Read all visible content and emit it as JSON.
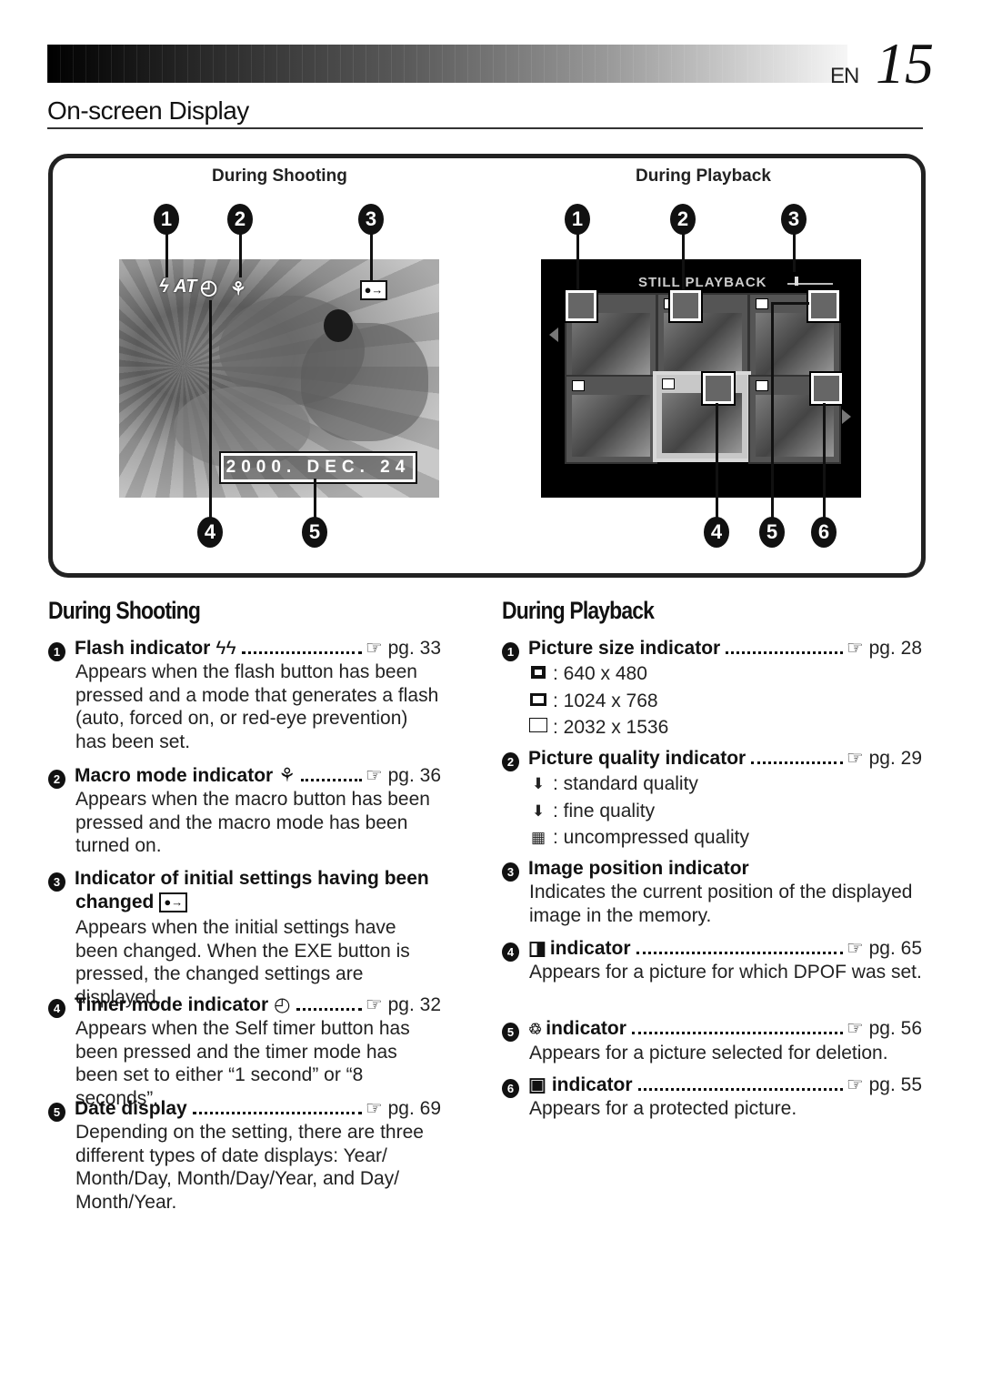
{
  "header": {
    "lang": "EN",
    "page_number": "15"
  },
  "page_title": "On-screen Display",
  "figure": {
    "shooting_caption": "During Shooting",
    "playback_caption": "During Playback",
    "shooting_callouts": [
      "1",
      "2",
      "3",
      "4",
      "5"
    ],
    "playback_callouts": [
      "1",
      "2",
      "3",
      "4",
      "5",
      "6"
    ],
    "shooting_osd": {
      "flash": "ϟ AT",
      "timer": "◴",
      "macro": "⚘",
      "init_changed": "●→",
      "date": "2000. DEC. 24"
    },
    "playback_osd": {
      "title": "STILL PLAYBACK"
    }
  },
  "shooting": {
    "heading": "During Shooting",
    "items": [
      {
        "num": "1",
        "label": "Flash indicator",
        "symbol": "ϟϟ",
        "ref": "☞ pg. 33",
        "desc": "Appears when the flash button has been pressed and a mode that generates a flash (auto, forced on, or red-eye prevention) has been set."
      },
      {
        "num": "2",
        "label": "Macro mode indicator",
        "symbol": "⚘",
        "ref": "☞ pg. 36",
        "desc": "Appears when the macro button has been pressed and the macro mode has been turned on."
      },
      {
        "num": "3",
        "label": "Indicator of initial settings having been",
        "label2": "changed",
        "symbol": "●→",
        "ref": "",
        "desc": "Appears when the initial settings have been changed. When the EXE button is pressed, the changed settings are displayed."
      },
      {
        "num": "4",
        "label": "Timer mode indicator",
        "symbol": "◴",
        "ref": "☞ pg. 32",
        "desc": "Appears when the Self timer button has been pressed and the timer mode has been set to either “1 second” or “8 seconds”."
      },
      {
        "num": "5",
        "label": "Date display",
        "symbol": "",
        "ref": "☞ pg. 69",
        "desc": "Depending on the setting, there are three different types of date displays: Year/ Month/Day, Month/Day/Year, and Day/ Month/Year."
      }
    ]
  },
  "playback": {
    "heading": "During Playback",
    "items": [
      {
        "num": "1",
        "label": "Picture size indicator",
        "ref": "☞ pg. 28",
        "options": [
          {
            "icon": "size-640-icon",
            "text": ": 640 x 480"
          },
          {
            "icon": "size-1024-icon",
            "text": ": 1024 x 768"
          },
          {
            "icon": "size-2032-icon",
            "text": ": 2032 x 1536"
          }
        ]
      },
      {
        "num": "2",
        "label": "Picture quality indicator",
        "ref": "☞ pg. 29",
        "options": [
          {
            "icon": "⬇",
            "text": ": standard quality"
          },
          {
            "icon": "⬇",
            "text": ": fine quality"
          },
          {
            "icon": "▦",
            "text": ": uncompressed quality"
          }
        ]
      },
      {
        "num": "3",
        "label": "Image position indicator",
        "ref": "",
        "desc": "Indicates the current position of the displayed image in the memory."
      },
      {
        "num": "4",
        "symbol": "◨",
        "label": "indicator",
        "ref": "☞ pg. 65",
        "desc": "Appears for a picture for which DPOF was set."
      },
      {
        "num": "5",
        "symbol": "♲",
        "label": "indicator",
        "ref": "☞ pg. 56",
        "desc": "Appears for a picture selected for deletion."
      },
      {
        "num": "6",
        "symbol": "▣",
        "label": "indicator",
        "ref": "☞ pg. 55",
        "desc": "Appears for a protected picture."
      }
    ]
  }
}
